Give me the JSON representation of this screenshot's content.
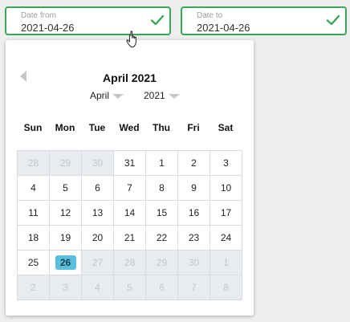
{
  "date_from": {
    "label": "Date from",
    "value": "2021-04-26",
    "icon": "check-icon"
  },
  "date_to": {
    "label": "Date to",
    "value": "2021-04-26",
    "icon": "check-icon"
  },
  "accent_color": "#3aa757",
  "calendar": {
    "title": "April 2021",
    "month_select": "April",
    "year_select": "2021",
    "prev_icon": "chevron-left-icon",
    "weekdays": [
      "Sun",
      "Mon",
      "Tue",
      "Wed",
      "Thu",
      "Fri",
      "Sat"
    ],
    "selected_color": "#5bc0de",
    "days": [
      {
        "label": "28",
        "state": "muted"
      },
      {
        "label": "29",
        "state": "muted"
      },
      {
        "label": "30",
        "state": "muted"
      },
      {
        "label": "31",
        "state": "normal"
      },
      {
        "label": "1",
        "state": "normal"
      },
      {
        "label": "2",
        "state": "normal"
      },
      {
        "label": "3",
        "state": "normal"
      },
      {
        "label": "4",
        "state": "normal"
      },
      {
        "label": "5",
        "state": "normal"
      },
      {
        "label": "6",
        "state": "normal"
      },
      {
        "label": "7",
        "state": "normal"
      },
      {
        "label": "8",
        "state": "normal"
      },
      {
        "label": "9",
        "state": "normal"
      },
      {
        "label": "10",
        "state": "normal"
      },
      {
        "label": "11",
        "state": "normal"
      },
      {
        "label": "12",
        "state": "normal"
      },
      {
        "label": "13",
        "state": "normal"
      },
      {
        "label": "14",
        "state": "normal"
      },
      {
        "label": "15",
        "state": "normal"
      },
      {
        "label": "16",
        "state": "normal"
      },
      {
        "label": "17",
        "state": "normal"
      },
      {
        "label": "18",
        "state": "normal"
      },
      {
        "label": "19",
        "state": "normal"
      },
      {
        "label": "20",
        "state": "normal"
      },
      {
        "label": "21",
        "state": "normal"
      },
      {
        "label": "22",
        "state": "normal"
      },
      {
        "label": "23",
        "state": "normal"
      },
      {
        "label": "24",
        "state": "normal"
      },
      {
        "label": "25",
        "state": "normal"
      },
      {
        "label": "26",
        "state": "selected"
      },
      {
        "label": "27",
        "state": "disabled"
      },
      {
        "label": "28",
        "state": "disabled"
      },
      {
        "label": "29",
        "state": "disabled"
      },
      {
        "label": "30",
        "state": "disabled"
      },
      {
        "label": "1",
        "state": "disabled"
      },
      {
        "label": "2",
        "state": "disabled"
      },
      {
        "label": "3",
        "state": "disabled"
      },
      {
        "label": "4",
        "state": "disabled"
      },
      {
        "label": "5",
        "state": "disabled"
      },
      {
        "label": "6",
        "state": "disabled"
      },
      {
        "label": "7",
        "state": "disabled"
      },
      {
        "label": "8",
        "state": "disabled"
      }
    ]
  },
  "cursor_icon": "hand-pointer-icon"
}
